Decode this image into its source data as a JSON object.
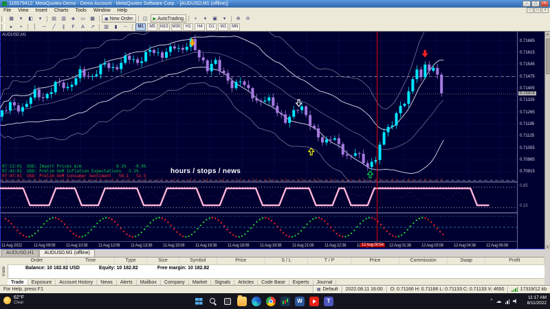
{
  "title_bar": {
    "title": "116579412: MetaQuotes-Demo - Demo Account - MetaQuotes Software Corp. - [AUDUSD,M1 (offline)]",
    "minimize": "–",
    "maximize": "□",
    "close": "×"
  },
  "menu": {
    "items": [
      "File",
      "View",
      "Insert",
      "Charts",
      "Tools",
      "Window",
      "Help"
    ]
  },
  "toolbar1": {
    "items": [
      {
        "t": "i",
        "g": "▦",
        "n": "new-chart"
      },
      {
        "t": "i",
        "g": "▾",
        "n": "new-chart-dropdown"
      },
      {
        "t": "i",
        "g": "◧",
        "n": "profiles"
      },
      {
        "t": "i",
        "g": "▾",
        "n": "profiles-dropdown"
      },
      {
        "t": "s"
      },
      {
        "t": "i",
        "g": "▤",
        "n": "market-watch"
      },
      {
        "t": "i",
        "g": "▥",
        "n": "data-window"
      },
      {
        "t": "i",
        "g": "◈",
        "n": "navigator"
      },
      {
        "t": "i",
        "g": "▭",
        "n": "terminal"
      },
      {
        "t": "i",
        "g": "▩",
        "n": "strategy-tester"
      },
      {
        "t": "s"
      },
      {
        "t": "b",
        "g": "▣",
        "label": "New Order",
        "n": "new-order"
      },
      {
        "t": "s"
      },
      {
        "t": "i",
        "g": "◫",
        "n": "metaeditor"
      },
      {
        "t": "b2",
        "g": "▶",
        "label": "AutoTrading",
        "n": "autotrading"
      },
      {
        "t": "s"
      },
      {
        "t": "i",
        "g": "+",
        "n": "add-indicator"
      },
      {
        "t": "i",
        "g": "▾",
        "n": "indicator-dropdown"
      },
      {
        "t": "i",
        "g": "▣",
        "n": "templates"
      },
      {
        "t": "i",
        "g": "▾",
        "n": "templates-dropdown"
      },
      {
        "t": "s"
      },
      {
        "t": "i",
        "g": "⊕",
        "n": "zoom-in"
      },
      {
        "t": "i",
        "g": "⊖",
        "n": "zoom-out"
      }
    ]
  },
  "toolbar2": {
    "tools": [
      {
        "g": "▸",
        "n": "cursor-tool"
      },
      {
        "g": "+",
        "n": "crosshair-tool"
      },
      {
        "t": "s"
      },
      {
        "g": "│",
        "n": "vertical-line-tool"
      },
      {
        "g": "─",
        "n": "horizontal-line-tool"
      },
      {
        "g": "╱",
        "n": "trendline-tool"
      },
      {
        "g": "∥",
        "n": "channel-tool"
      },
      {
        "g": "F",
        "n": "fibonacci-tool"
      },
      {
        "g": "A",
        "n": "text-tool"
      },
      {
        "g": "↗",
        "n": "arrow-tool"
      },
      {
        "t": "s"
      },
      {
        "g": "▥",
        "n": "bar-chart-mode"
      },
      {
        "g": "▮",
        "n": "candlestick-mode"
      },
      {
        "g": "~",
        "n": "line-chart-mode"
      }
    ],
    "timeframes": [
      "M1",
      "M5",
      "M15",
      "M30",
      "H1",
      "H4",
      "D1",
      "W1",
      "MN"
    ],
    "active_timeframe": "M1"
  },
  "chart": {
    "symbol_label": "AUDUSD,M1",
    "overlay_text": "hours / stops / news",
    "news_lines": [
      {
        "text": "07:13:01  USD: Import Prices m/m              0.2%   -0.9%",
        "color": "#00cc44"
      },
      {
        "text": "07:43:01  USD: Prelim UoM Inflation Expectations   5.2%",
        "color": "#00cc44"
      },
      {
        "text": "07:47:01  USD: Prelim UoM Consumer Sentiment   59.1   52.5",
        "color": "#ff3333"
      }
    ],
    "colors": {
      "background": "#000030",
      "up_candle": "#00e5ff",
      "down_candle": "#a57ae0",
      "band": "#e6e6f8",
      "grid": "#16166a",
      "vline": "#dd0000",
      "pink": "#ff9ccc",
      "dots_up": "#22cc33",
      "dots_down": "#ee2222",
      "level": "#d8d8d8"
    },
    "price_max": 0.7174,
    "price_min": 0.7086,
    "price_labels": [
      "0.71685",
      "0.71615",
      "0.71545",
      "0.71475",
      "0.71405",
      "0.71335",
      "0.71265",
      "0.71195",
      "0.71125",
      "0.71055",
      "0.70985",
      "0.70915"
    ],
    "current_price": "0.71373",
    "levels": [
      0.71475,
      0.70865
    ],
    "vline_x": 0.7287,
    "price_path": [
      [
        0.0,
        0.7124
      ],
      [
        0.025,
        0.7132
      ],
      [
        0.045,
        0.7127
      ],
      [
        0.07,
        0.7139
      ],
      [
        0.09,
        0.7134
      ],
      [
        0.115,
        0.7145
      ],
      [
        0.135,
        0.714
      ],
      [
        0.16,
        0.7151
      ],
      [
        0.18,
        0.7146
      ],
      [
        0.205,
        0.7156
      ],
      [
        0.225,
        0.7151
      ],
      [
        0.25,
        0.716
      ],
      [
        0.27,
        0.7155
      ],
      [
        0.295,
        0.7164
      ],
      [
        0.315,
        0.7159
      ],
      [
        0.34,
        0.7166
      ],
      [
        0.355,
        0.7162
      ],
      [
        0.372,
        0.7169
      ],
      [
        0.388,
        0.716
      ],
      [
        0.405,
        0.7152
      ],
      [
        0.42,
        0.7157
      ],
      [
        0.438,
        0.7148
      ],
      [
        0.455,
        0.7141
      ],
      [
        0.47,
        0.7146
      ],
      [
        0.488,
        0.7138
      ],
      [
        0.505,
        0.7131
      ],
      [
        0.52,
        0.7136
      ],
      [
        0.538,
        0.7128
      ],
      [
        0.555,
        0.7121
      ],
      [
        0.57,
        0.7126
      ],
      [
        0.585,
        0.7131
      ],
      [
        0.6,
        0.7122
      ],
      [
        0.615,
        0.7114
      ],
      [
        0.632,
        0.7108
      ],
      [
        0.648,
        0.7113
      ],
      [
        0.663,
        0.7105
      ],
      [
        0.678,
        0.7099
      ],
      [
        0.692,
        0.7104
      ],
      [
        0.705,
        0.7098
      ],
      [
        0.718,
        0.7094
      ],
      [
        0.73,
        0.7099
      ],
      [
        0.7375,
        0.7106
      ],
      [
        0.7456,
        0.7113
      ],
      [
        0.7537,
        0.712
      ],
      [
        0.7612,
        0.7116
      ],
      [
        0.7693,
        0.7125
      ],
      [
        0.7775,
        0.7132
      ],
      [
        0.785,
        0.7128
      ],
      [
        0.7924,
        0.7138
      ],
      [
        0.8006,
        0.7145
      ],
      [
        0.8087,
        0.7151
      ],
      [
        0.8174,
        0.7148
      ],
      [
        0.8262,
        0.7154
      ],
      [
        0.8349,
        0.715
      ],
      [
        0.8437,
        0.7155
      ],
      [
        0.8512,
        0.7146
      ],
      [
        0.858,
        0.7138
      ]
    ],
    "arrows": [
      {
        "x": 0.372,
        "price": 0.71655,
        "dir": "down",
        "color": "#ffaa00",
        "hollow": false
      },
      {
        "x": 0.578,
        "price": 0.713,
        "dir": "down",
        "color": "#ffffff",
        "hollow": true
      },
      {
        "x": 0.602,
        "price": 0.71055,
        "dir": "up",
        "color": "#ffff00",
        "hollow": true
      },
      {
        "x": 0.716,
        "price": 0.7092,
        "dir": "up",
        "color": "#00dd44",
        "hollow": true
      },
      {
        "x": 0.822,
        "price": 0.7159,
        "dir": "down",
        "color": "#ff2020",
        "hollow": false
      }
    ],
    "time_labels": [
      "11 Aug 2022",
      "11 Aug 09:08",
      "11 Aug 10:38",
      "11 Aug 12:08",
      "11 Aug 13:38",
      "11 Aug 15:08",
      "11 Aug 16:38",
      "11 Aug 18:08",
      "11 Aug 19:38",
      "11 Aug 21:08",
      "11 Aug 22:38",
      "12 Aug 00:08",
      "12 Aug 01:38",
      "12 Aug 03:08",
      "12 Aug 04:38",
      "12 Aug 06:08"
    ],
    "time_highlight": "12 Aug 00:54",
    "panel1": {
      "level_labels": [
        "0.85",
        "0.15"
      ],
      "path": [
        [
          0.0,
          0.1
        ],
        [
          0.045,
          0.1
        ],
        [
          0.058,
          0.85
        ],
        [
          0.095,
          0.85
        ],
        [
          0.108,
          0.1
        ],
        [
          0.145,
          0.1
        ],
        [
          0.158,
          0.85
        ],
        [
          0.19,
          0.85
        ],
        [
          0.203,
          0.1
        ],
        [
          0.265,
          0.1
        ],
        [
          0.278,
          0.85
        ],
        [
          0.31,
          0.85
        ],
        [
          0.323,
          0.1
        ],
        [
          0.38,
          0.1
        ],
        [
          0.393,
          0.85
        ],
        [
          0.425,
          0.85
        ],
        [
          0.438,
          0.1
        ],
        [
          0.495,
          0.1
        ],
        [
          0.508,
          0.85
        ],
        [
          0.54,
          0.85
        ],
        [
          0.553,
          0.1
        ],
        [
          0.598,
          0.1
        ],
        [
          0.611,
          0.85
        ],
        [
          0.643,
          0.85
        ],
        [
          0.656,
          0.1
        ],
        [
          0.666,
          0.1
        ],
        [
          0.679,
          0.85
        ],
        [
          0.711,
          0.85
        ],
        [
          0.724,
          0.1
        ],
        [
          0.91,
          0.1
        ],
        [
          0.923,
          0.85
        ],
        [
          0.945,
          0.85
        ]
      ]
    }
  },
  "symbol_tabs": {
    "tabs": [
      {
        "label": "AUDUSD,H1",
        "active": false
      },
      {
        "label": "AUDUSD,M1 (offline)",
        "active": true
      }
    ]
  },
  "toolbox": {
    "side_tab": "Trade",
    "columns": [
      "Order",
      "Time",
      "Type",
      "Size",
      "Symbol",
      "Price",
      "S / L",
      "T / P",
      "Price",
      "Commission",
      "Swap",
      "Profit"
    ],
    "balance_items": [
      "Balance: 10 182.82 USD",
      "Equity: 10 182.82",
      "Free margin: 10 182.82"
    ],
    "tabs": [
      "Trade",
      "Exposure",
      "Account History",
      "News",
      "Alerts",
      "Mailbox",
      "Company",
      "Market",
      "Signals",
      "Articles",
      "Code Base",
      "Experts",
      "Journal"
    ],
    "active_tab": "Trade"
  },
  "status_bar": {
    "help_text": "For Help, press F1",
    "profile": "Default",
    "datetime": "2022.08.11 16:00",
    "ohlcv": "O: 0.71166 H: 0.71166 L: 0.71133 C: 0.71133 V: 4650",
    "connection": "17319/12 kb"
  },
  "taskbar": {
    "weather_temp": "62°F",
    "weather_desc": "Clear",
    "clock_time": "11:17 AM",
    "clock_date": "8/11/2022",
    "apps": [
      {
        "n": "start"
      },
      {
        "n": "search"
      },
      {
        "n": "taskview"
      },
      {
        "n": "folder"
      },
      {
        "n": "edge"
      },
      {
        "n": "chrome"
      },
      {
        "n": "mt4"
      },
      {
        "n": "word",
        "label": "W"
      },
      {
        "n": "youtube"
      },
      {
        "n": "teams",
        "label": "T"
      }
    ]
  }
}
